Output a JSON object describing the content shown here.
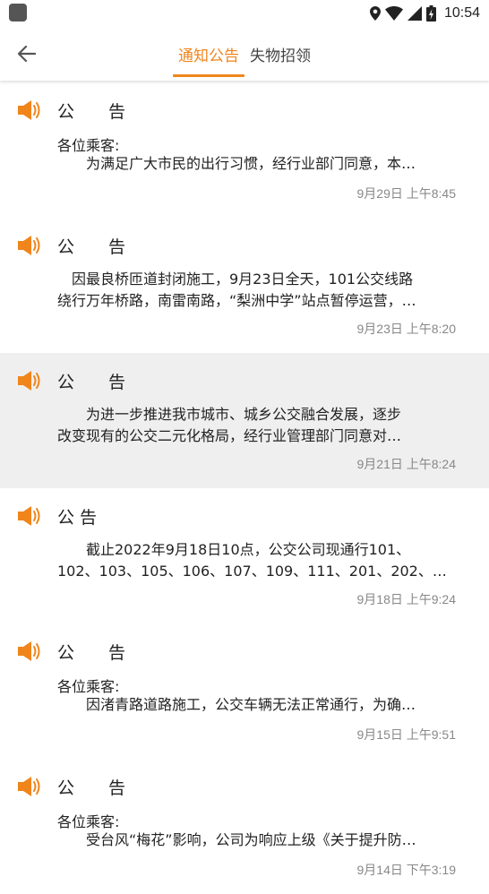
{
  "status_bar": {
    "time": "10:54"
  },
  "header": {
    "tabs": [
      {
        "label": "通知公告"
      },
      {
        "label": "失物招领"
      }
    ]
  },
  "notices": [
    {
      "title": "公　　告",
      "salutation": "各位乘客:",
      "lines": [
        "　　为满足广大市民的出行习惯，经行业部门同意，本…"
      ],
      "date": "9月29日 上午8:45"
    },
    {
      "title": "公　　告",
      "salutation": "",
      "lines": [
        "　因最良桥匝道封闭施工，9月23日全天，101公交线路",
        "绕行万年桥路，南雷南路，“梨洲中学”站点暂停运营，…"
      ],
      "date": "9月23日 上午8:20"
    },
    {
      "title": "公　　告",
      "salutation": "",
      "lines": [
        "　　为进一步推进我市城市、城乡公交融合发展，逐步",
        "改变现有的公交二元化格局，经行业管理部门同意对…"
      ],
      "date": "9月21日 上午8:24"
    },
    {
      "title": "公 告",
      "salutation": "",
      "lines": [
        "　　截止2022年9月18日10点，公交公司现通行101、",
        "102、103、105、106、107、109、111、201、202、…"
      ],
      "date": "9月18日 上午9:24"
    },
    {
      "title": "公　　告",
      "salutation": "各位乘客:",
      "lines": [
        "　　因渚青路道路施工，公交车辆无法正常通行，为确…"
      ],
      "date": "9月15日 上午9:51"
    },
    {
      "title": "公　　告",
      "salutation": "各位乘客:",
      "lines": [
        "　　受台风“梅花”影响，公司为响应上级《关于提升防…"
      ],
      "date": "9月14日 下午3:19"
    }
  ]
}
